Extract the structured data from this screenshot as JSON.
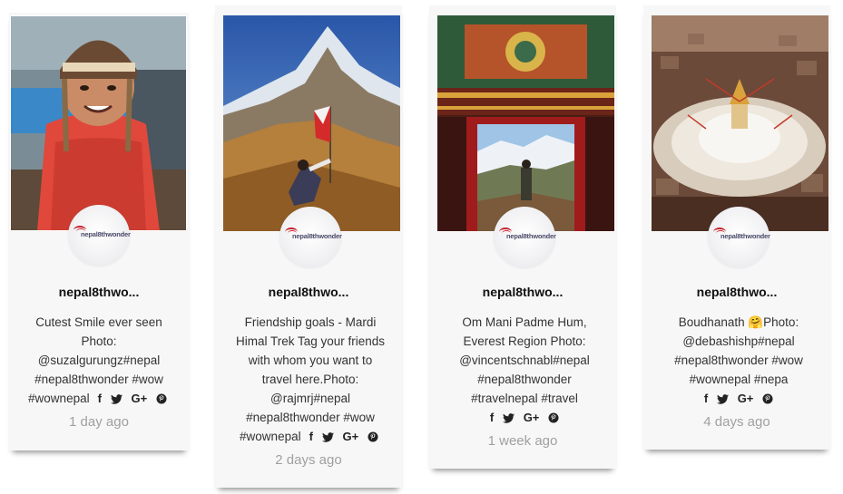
{
  "posts": [
    {
      "username": "nepal8thwo...",
      "avatar_logo": "nepal8thwonder",
      "caption_lines": [
        "Cutest Smile ever seen",
        "Photo:",
        "@suzalgurungz#nepal",
        "#nepal8thwonder #wow",
        "#wownepal"
      ],
      "time": "1 day ago",
      "photo": "smiling-child-in-knit-hat"
    },
    {
      "username": "nepal8thwo...",
      "avatar_logo": "nepal8thwonder",
      "caption_lines": [
        "Friendship goals - Mardi",
        "Himal Trek Tag your friends",
        "with whom you want to",
        "travel here.Photo:",
        "@rajmrj#nepal",
        "#nepal8thwonder #wow",
        "#wownepal"
      ],
      "time": "2 days ago",
      "photo": "mountain-peak-with-flag"
    },
    {
      "username": "nepal8thwo...",
      "avatar_logo": "nepal8thwonder",
      "caption_lines": [
        "Om Mani Padme Hum,",
        "Everest Region Photo:",
        "@vincentschnabl#nepal",
        "#nepal8thwonder",
        "#travelnepal #travel"
      ],
      "time": "1 week ago",
      "photo": "monastery-doorway-view"
    },
    {
      "username": "nepal8thwo...",
      "avatar_logo": "nepal8thwonder",
      "caption_lines": [
        "Boudhanath 🤗Photo:",
        "@debashishp#nepal",
        "#nepal8thwonder #wow",
        "#wownepal #nepa"
      ],
      "time": "4 days ago",
      "photo": "boudhanath-stupa-aerial"
    }
  ],
  "share_icons": [
    "facebook-icon",
    "twitter-icon",
    "google-plus-icon",
    "pinterest-icon"
  ],
  "share_labels": {
    "facebook": "f",
    "google": "G+"
  }
}
